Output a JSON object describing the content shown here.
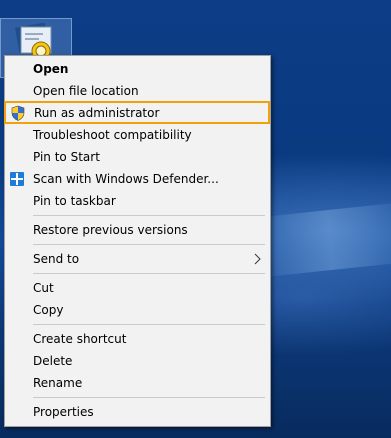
{
  "desktop": {
    "icon_name": "desktop-app-shortcut-icon"
  },
  "context_menu": {
    "items": [
      {
        "label": "Open",
        "bold": true,
        "icon": null
      },
      {
        "label": "Open file location",
        "icon": null
      },
      {
        "label": "Run as administrator",
        "icon": "uac-shield-icon",
        "highlighted": true,
        "highlight_color": "#f0a20a"
      },
      {
        "label": "Troubleshoot compatibility",
        "icon": null
      },
      {
        "label": "Pin to Start",
        "icon": null
      },
      {
        "label": "Scan with Windows Defender...",
        "icon": "windows-defender-icon"
      },
      {
        "label": "Pin to taskbar",
        "icon": null
      },
      {
        "label": "Restore previous versions",
        "icon": null
      },
      {
        "label": "Send to",
        "icon": null,
        "submenu": true
      },
      {
        "label": "Cut",
        "icon": null
      },
      {
        "label": "Copy",
        "icon": null
      },
      {
        "label": "Create shortcut",
        "icon": null
      },
      {
        "label": "Delete",
        "icon": null
      },
      {
        "label": "Rename",
        "icon": null
      },
      {
        "label": "Properties",
        "icon": null
      }
    ]
  },
  "colors": {
    "menu_background": "#f2f2f2",
    "highlight_border": "#f0a20a",
    "separator": "#cacaca"
  }
}
